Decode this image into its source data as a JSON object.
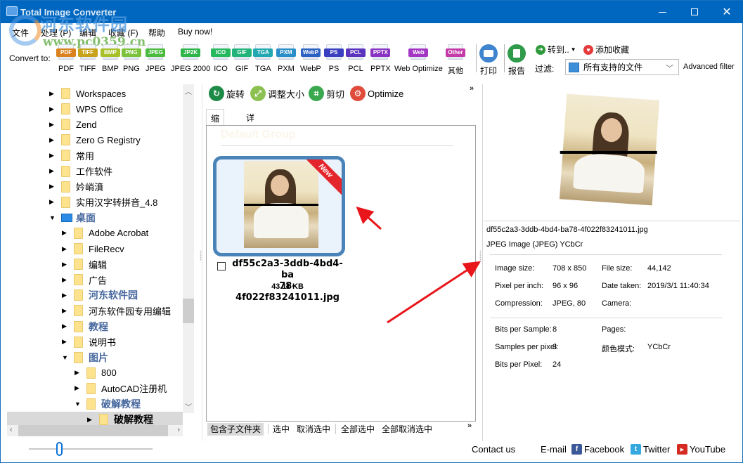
{
  "window": {
    "title": "Total Image Converter",
    "controls": {
      "minimize": "minimize",
      "maximize": "maximize",
      "close": "close"
    }
  },
  "watermark": {
    "site_name": "河东软件园",
    "url": "www.pc0359.cn"
  },
  "menu": [
    "文件",
    "处理 (P)",
    "编辑",
    "收藏 (F)",
    "帮助",
    "Buy now!"
  ],
  "convert": {
    "label": "Convert to:",
    "formats": [
      {
        "badge": "PDF",
        "label": "PDF",
        "color": "#d9821f"
      },
      {
        "badge": "TIFF",
        "label": "TIFF",
        "color": "#c7a21a"
      },
      {
        "badge": "BMP",
        "label": "BMP",
        "color": "#a8c02a"
      },
      {
        "badge": "PNG",
        "label": "PNG",
        "color": "#7cc23a"
      },
      {
        "badge": "JPEG",
        "label": "JPEG",
        "color": "#4bbb3e"
      },
      {
        "badge": "JP2K",
        "label": "JPEG 2000",
        "color": "#2fb54a"
      },
      {
        "badge": "ICO",
        "label": "ICO",
        "color": "#25b85d"
      },
      {
        "badge": "GIF",
        "label": "GIF",
        "color": "#22b47a"
      },
      {
        "badge": "TGA",
        "label": "TGA",
        "color": "#22a8b0"
      },
      {
        "badge": "PXM",
        "label": "PXM",
        "color": "#2a8fc9"
      },
      {
        "badge": "WebP",
        "label": "WebP",
        "color": "#2e62c2"
      },
      {
        "badge": "PS",
        "label": "PS",
        "color": "#3a3fc0"
      },
      {
        "badge": "PCL",
        "label": "PCL",
        "color": "#5b33bd"
      },
      {
        "badge": "PPTX",
        "label": "PPTX",
        "color": "#8a34c4"
      },
      {
        "badge": "Web",
        "label": "Web Optimize",
        "color": "#a337c4"
      },
      {
        "badge": "Other",
        "label": "其他",
        "color": "#c43aa8"
      }
    ]
  },
  "toolbar": {
    "print": "打印",
    "report": "报告",
    "goto": "转到..",
    "add_favorite": "添加收藏",
    "filter_label": "过滤:",
    "filter_value": "所有支持的文件",
    "advanced_filter": "Advanced filter"
  },
  "tree": [
    {
      "label": "Workspaces",
      "expanded": false,
      "level": 0,
      "style": "normal"
    },
    {
      "label": "WPS Office",
      "expanded": false,
      "level": 0,
      "style": "normal"
    },
    {
      "label": "Zend",
      "expanded": false,
      "level": 0,
      "style": "normal"
    },
    {
      "label": "Zero G Registry",
      "expanded": false,
      "level": 0,
      "style": "normal"
    },
    {
      "label": "常用",
      "expanded": false,
      "level": 0,
      "style": "normal"
    },
    {
      "label": "工作软件",
      "expanded": false,
      "level": 0,
      "style": "normal"
    },
    {
      "label": "妗峭濆",
      "expanded": false,
      "level": 0,
      "style": "normal"
    },
    {
      "label": "实用汉字转拼音_4.8",
      "expanded": false,
      "level": 0,
      "style": "normal"
    },
    {
      "label": "桌面",
      "expanded": true,
      "level": 0,
      "style": "bold",
      "icon": "desktop"
    },
    {
      "label": "Adobe Acrobat",
      "expanded": false,
      "level": 1,
      "style": "normal"
    },
    {
      "label": "FileRecv",
      "expanded": false,
      "level": 1,
      "style": "normal"
    },
    {
      "label": "编辑",
      "expanded": false,
      "level": 1,
      "style": "normal"
    },
    {
      "label": "广告",
      "expanded": false,
      "level": 1,
      "style": "normal"
    },
    {
      "label": "河东软件园",
      "expanded": false,
      "level": 1,
      "style": "bold"
    },
    {
      "label": "河东软件园专用编辑",
      "expanded": false,
      "level": 1,
      "style": "normal"
    },
    {
      "label": "教程",
      "expanded": false,
      "level": 1,
      "style": "bold"
    },
    {
      "label": "说明书",
      "expanded": false,
      "level": 1,
      "style": "normal"
    },
    {
      "label": "图片",
      "expanded": true,
      "level": 1,
      "style": "bold"
    },
    {
      "label": "800",
      "expanded": false,
      "level": 2,
      "style": "normal"
    },
    {
      "label": "AutoCAD注册机",
      "expanded": false,
      "level": 2,
      "style": "normal"
    },
    {
      "label": "破解教程",
      "expanded": true,
      "level": 2,
      "style": "bold"
    },
    {
      "label": "破解教程",
      "expanded": false,
      "level": 3,
      "style": "bold-dark",
      "selected": true
    }
  ],
  "zoom_slider": {
    "value_fraction": 0.25
  },
  "center": {
    "actions": [
      "旋转",
      "调整大小",
      "剪切",
      "Optimize"
    ],
    "tabs": [
      "缩略图",
      "详细信息"
    ],
    "active_tab": 0,
    "group_title": "Default Group",
    "file": {
      "name_line1": "df55c2a3-3ddb-4bd4-ba",
      "name_line2": "78-4f022f83241011.jpg",
      "size": "43.11 KB",
      "badge": "New",
      "checked": false
    },
    "bottom": [
      "包含子文件夹",
      "选中",
      "取消选中",
      "全部选中",
      "全部取消选中"
    ]
  },
  "details": {
    "filename": "df55c2a3-3ddb-4bd4-ba78-4f022f83241011.jpg",
    "type": "JPEG Image (JPEG) YCbCr",
    "rows1": [
      {
        "label": "Image size:",
        "value": "708 x 850",
        "label2": "File size:",
        "value2": "44,142"
      },
      {
        "label": "Pixel per inch:",
        "value": "96 x 96",
        "label2": "Date taken:",
        "value2": "2019/3/1 11:40:34"
      },
      {
        "label": "Compression:",
        "value": "JPEG, 80",
        "label2": "Camera:",
        "value2": ""
      }
    ],
    "rows2": [
      {
        "label": "Bits per Sample:",
        "value": "8",
        "label2": "Pages:",
        "value2": ""
      },
      {
        "label": "Samples per pixel:",
        "value": "3",
        "label2": "颜色模式:",
        "value2": "YCbCr"
      },
      {
        "label": "Bits per Pixel:",
        "value": "24",
        "label2": "",
        "value2": ""
      }
    ]
  },
  "footer": {
    "contact": "Contact us",
    "email": "E-mail",
    "facebook": "Facebook",
    "twitter": "Twitter",
    "youtube": "YouTube"
  },
  "colors": {
    "titlebar": "#0067c0",
    "card_border": "#4a83b8",
    "annotation_arrow": "#e8161b",
    "tree_bold_text": "#46679e"
  }
}
